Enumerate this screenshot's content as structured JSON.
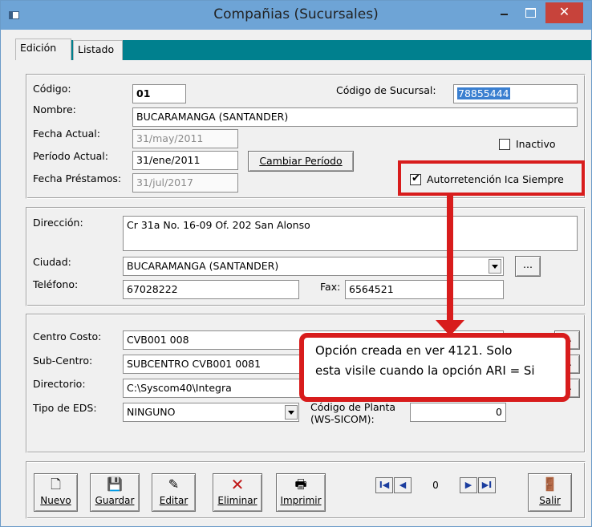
{
  "window": {
    "title": "Compañias (Sucursales)",
    "close_label": "✕"
  },
  "tabs": [
    {
      "label": "Edición"
    },
    {
      "label": "Listado"
    }
  ],
  "general": {
    "codigo_label": "Código:",
    "codigo_value": "01",
    "codigo_sucursal_label": "Código de Sucursal:",
    "codigo_sucursal_value": "78855444",
    "nombre_label": "Nombre:",
    "nombre_value": "BUCARAMANGA  (SANTANDER)",
    "fecha_actual_label": "Fecha Actual:",
    "fecha_actual_value": "31/may/2011",
    "periodo_actual_label": "Período Actual:",
    "periodo_actual_value": "31/ene/2011",
    "cambiar_periodo_label": "Cambiar Período",
    "fecha_prestamos_label": "Fecha Préstamos:",
    "fecha_prestamos_value": "31/jul/2017",
    "inactivo_label": "Inactivo",
    "inactivo_checked": false,
    "autorretencion_label": "Autorretención Ica Siempre",
    "autorretencion_checked": true
  },
  "contact": {
    "direccion_label": "Dirección:",
    "direccion_value": "Cr 31a No. 16-09 Of. 202 San Alonso",
    "ciudad_label": "Ciudad:",
    "ciudad_value": "BUCARAMANGA  (SANTANDER)",
    "ellipsis": "...",
    "telefono_label": "Teléfono:",
    "telefono_value": "67028222",
    "fax_label": "Fax:",
    "fax_value": "6564521"
  },
  "cost": {
    "centro_costo_label": "Centro Costo:",
    "centro_costo_value": "CVB001 008",
    "sub_centro_label": "Sub-Centro:",
    "sub_centro_value": "SUBCENTRO CVB001 0081",
    "directorio_label": "Directorio:",
    "directorio_value": "C:\\Syscom40\\Integra",
    "tipo_eds_label": "Tipo de EDS:",
    "tipo_eds_value": "NINGUNO",
    "codigo_planta_label_1": "Código de Planta",
    "codigo_planta_label_2": "(WS-SICOM):",
    "codigo_planta_value": "0",
    "ellipsis": "..."
  },
  "callout": {
    "line1": "Opción creada en ver 4121. Solo",
    "line2": "esta visile cuando la opción ARI = Si",
    "color": "#d81c1c"
  },
  "toolbar": {
    "nuevo": "Nuevo",
    "guardar": "Guardar",
    "editar": "Editar",
    "eliminar": "Eliminar",
    "imprimir": "Imprimir",
    "salir": "Salir",
    "record_number": "0",
    "nav_first": "I◀",
    "nav_prev": "◀",
    "nav_next": "▶",
    "nav_last": "▶I"
  },
  "icons": {
    "nuevo": "new-document-icon",
    "guardar": "floppy-disk-icon",
    "editar": "edit-icon",
    "eliminar": "delete-x-icon",
    "imprimir": "printer-icon",
    "salir": "exit-door-icon"
  },
  "colors": {
    "titlebar": "#6ea4d6",
    "tabbar": "#00808e",
    "accent_red": "#d81c1c",
    "selection": "#3a7fd0"
  }
}
